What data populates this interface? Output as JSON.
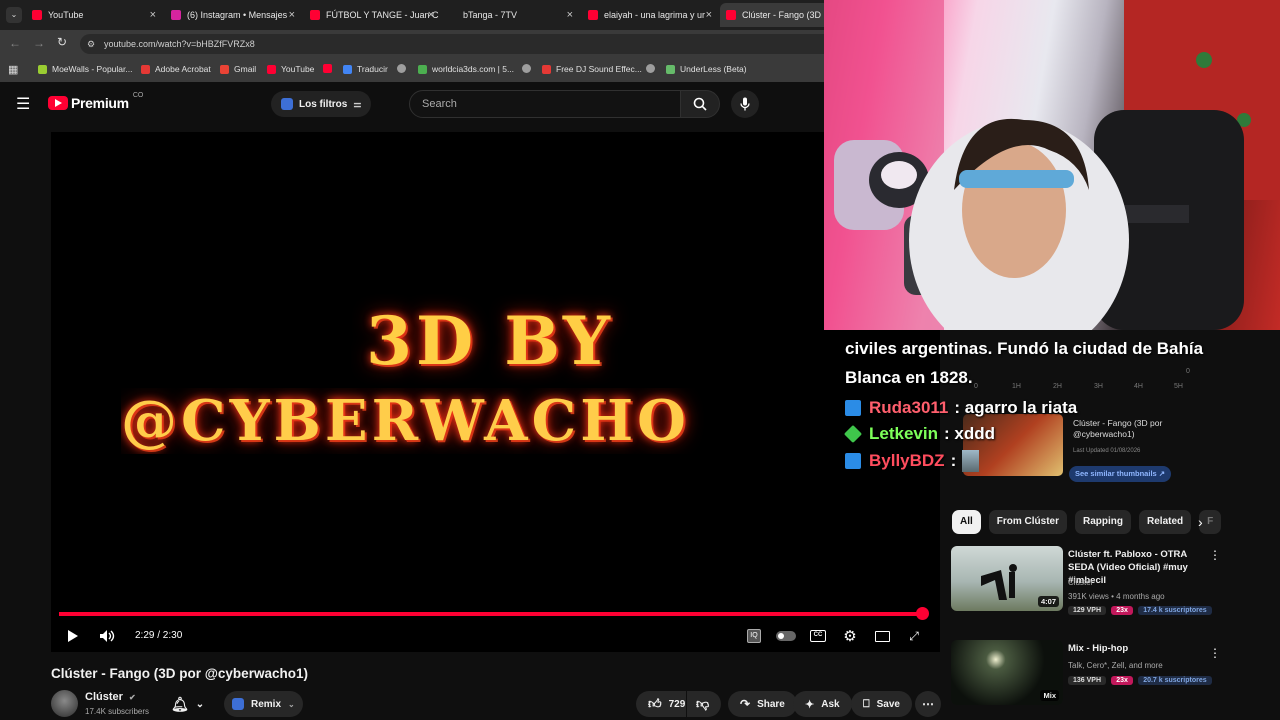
{
  "browser": {
    "tabs": [
      {
        "label": "YouTube",
        "color": "#ff0033"
      },
      {
        "label": "(6) Instagram • Mensajes",
        "color": "#d6249f"
      },
      {
        "label": "FÚTBOL Y TANGE - Juan C",
        "color": "#ff0033"
      },
      {
        "label": "bTanga - 7TV",
        "color": ""
      },
      {
        "label": "elaiyah - una lagrima y ur",
        "color": "#ff0033"
      },
      {
        "label": "Clúster - Fango (3D por",
        "color": "#ff0033"
      }
    ],
    "url": "youtube.com/watch?v=bHBZfFVRZx8",
    "bookmarks": [
      {
        "label": "MoeWalls - Popular...",
        "color": "#9acd32"
      },
      {
        "label": "Adobe Acrobat",
        "color": "#e53935"
      },
      {
        "label": "Gmail",
        "color": "#ea4335"
      },
      {
        "label": "YouTube",
        "color": "#ff0033"
      },
      {
        "label": "",
        "color": "#ff0033"
      },
      {
        "label": "Traducir",
        "color": "#4285f4"
      },
      {
        "label": "",
        "color": "#9e9e9e"
      },
      {
        "label": "worldcia3ds.com | 5...",
        "color": "#4caf50"
      },
      {
        "label": "",
        "color": "#9e9e9e"
      },
      {
        "label": "Free DJ Sound Effec...",
        "color": "#e53935"
      },
      {
        "label": "",
        "color": "#9e9e9e"
      },
      {
        "label": "UnderLess (Beta)",
        "color": "#66bb6a"
      }
    ]
  },
  "youtube": {
    "logo_text": "Premium",
    "country": "CO",
    "filters_label": "Los filtros",
    "search_placeholder": "Search"
  },
  "player": {
    "overlay_line1": "3D BY",
    "overlay_line2": "@CYBERWACHO",
    "time": "2:29 / 2:30",
    "progress": 0.993
  },
  "video": {
    "title": "Clúster - Fango (3D por @cyberwacho1)",
    "channel": "Clúster",
    "subscribers": "17.4K subscribers",
    "remix_label": "Remix",
    "likes": "729",
    "share_label": "Share",
    "ask_label": "Ask",
    "save_label": "Save"
  },
  "overlay": {
    "caption": "civiles argentinas. Fundó la ciudad de Bahía Blanca en 1828.",
    "chat": [
      {
        "user": "Ruda3011",
        "message": ": agarro la riata",
        "user_color": "#ff5f6d",
        "badge_color": "#2b8ce6"
      },
      {
        "user": "Letkevin",
        "message": ": xddd",
        "user_color": "#7dff5a",
        "badge_color": "#3fc64b"
      },
      {
        "user": "ByllyBDZ",
        "message": ":",
        "user_color": "#ff4d5e",
        "badge_color": "#2b8ce6"
      }
    ],
    "graph_ticks": [
      "0",
      "1H",
      "2H",
      "3H",
      "4H",
      "5H"
    ],
    "graph_zero": "0"
  },
  "ad_card": {
    "title": "Clúster - Fango (3D por @cyberwacho1)",
    "updated": "Last Updated 01/08/2026",
    "button": "See similar thumbnails ↗"
  },
  "chips": [
    "All",
    "From Clúster",
    "Rapping",
    "Related",
    "F"
  ],
  "recommendations": [
    {
      "title": "Clúster ft. Pabloxo - OTRA SEDA (Video Oficial) #muy #imbecil",
      "channel": "Clúster",
      "stats": "391K views • 4 months ago",
      "vph": "129 VPH",
      "mult": "23x",
      "subs": "17.4 k suscriptores",
      "duration": "4:07"
    },
    {
      "title": "Mix - Hip-hop",
      "channel": "Talk, Cero*, Zell, and more",
      "stats": "",
      "vph": "136 VPH",
      "mult": "23x",
      "subs": "20.7 k suscriptores",
      "duration": "Mix"
    }
  ]
}
